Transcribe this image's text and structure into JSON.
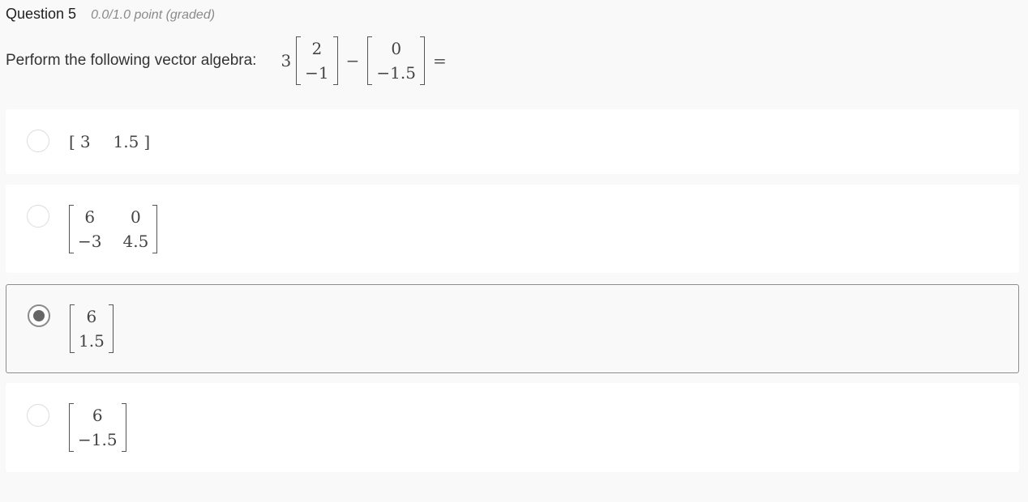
{
  "question": {
    "title": "Question 5",
    "points": "0.0/1.0 point (graded)",
    "prompt": "Perform the following vector algebra:",
    "expression": {
      "scalar": "3",
      "vec_a": [
        "2",
        "−1"
      ],
      "minus": "−",
      "vec_b": [
        "0",
        "−1.5"
      ],
      "equals": "="
    }
  },
  "options": [
    {
      "cells": [
        "3",
        "1.5"
      ],
      "selected": false
    },
    {
      "cells": [
        "6",
        "0",
        "−3",
        "4.5"
      ],
      "selected": false
    },
    {
      "cells": [
        "6",
        "1.5"
      ],
      "selected": true
    },
    {
      "cells": [
        "6",
        "−1.5"
      ],
      "selected": false
    }
  ]
}
